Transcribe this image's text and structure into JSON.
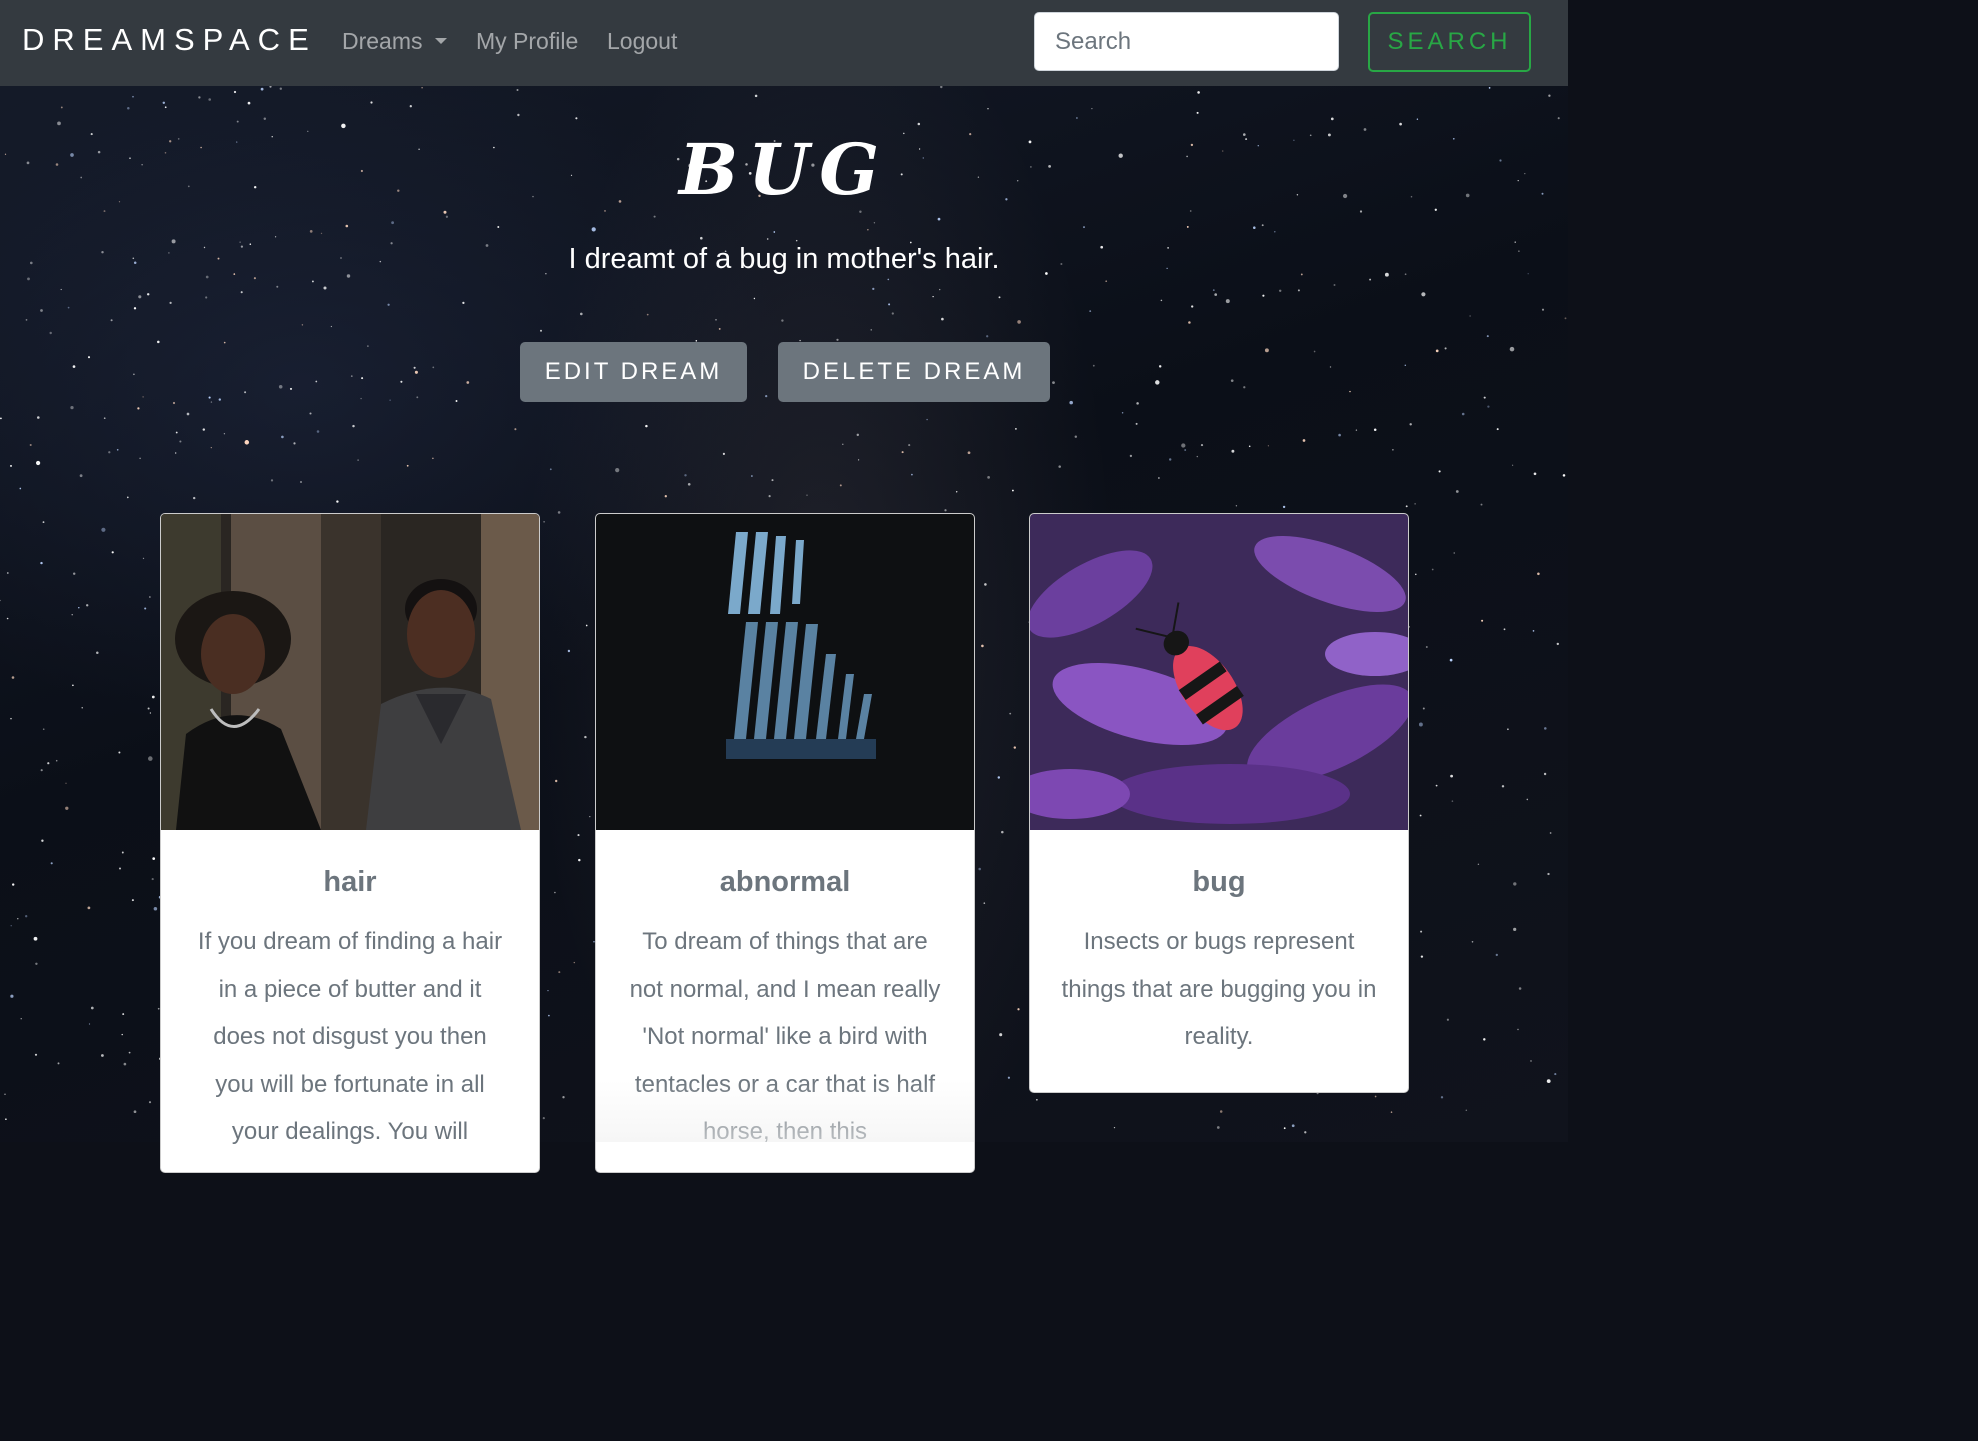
{
  "navbar": {
    "brand": "DREAMSPACE",
    "links": {
      "dreams": "Dreams",
      "profile": "My Profile",
      "logout": "Logout"
    },
    "search": {
      "placeholder": "Search",
      "button_label": "SEARCH"
    }
  },
  "dream": {
    "title": "BUG",
    "text": "I dreamt of a bug in mother's hair.",
    "edit_label": "EDIT DREAM",
    "delete_label": "DELETE DREAM"
  },
  "cards": [
    {
      "title": "hair",
      "text": "If you dream of finding a hair in a piece of butter and it does not disgust you then you will be fortunate in all your dealings. You will"
    },
    {
      "title": "abnormal",
      "text": "To dream of things that are not normal, and I mean really 'Not normal' like a bird with tentacles or a car that is half horse, then this"
    },
    {
      "title": "bug",
      "text": "Insects or bugs represent things that are bugging you in reality."
    }
  ],
  "colors": {
    "navbar": "#343a40",
    "success": "#28a745",
    "secondary": "#6c757d"
  }
}
